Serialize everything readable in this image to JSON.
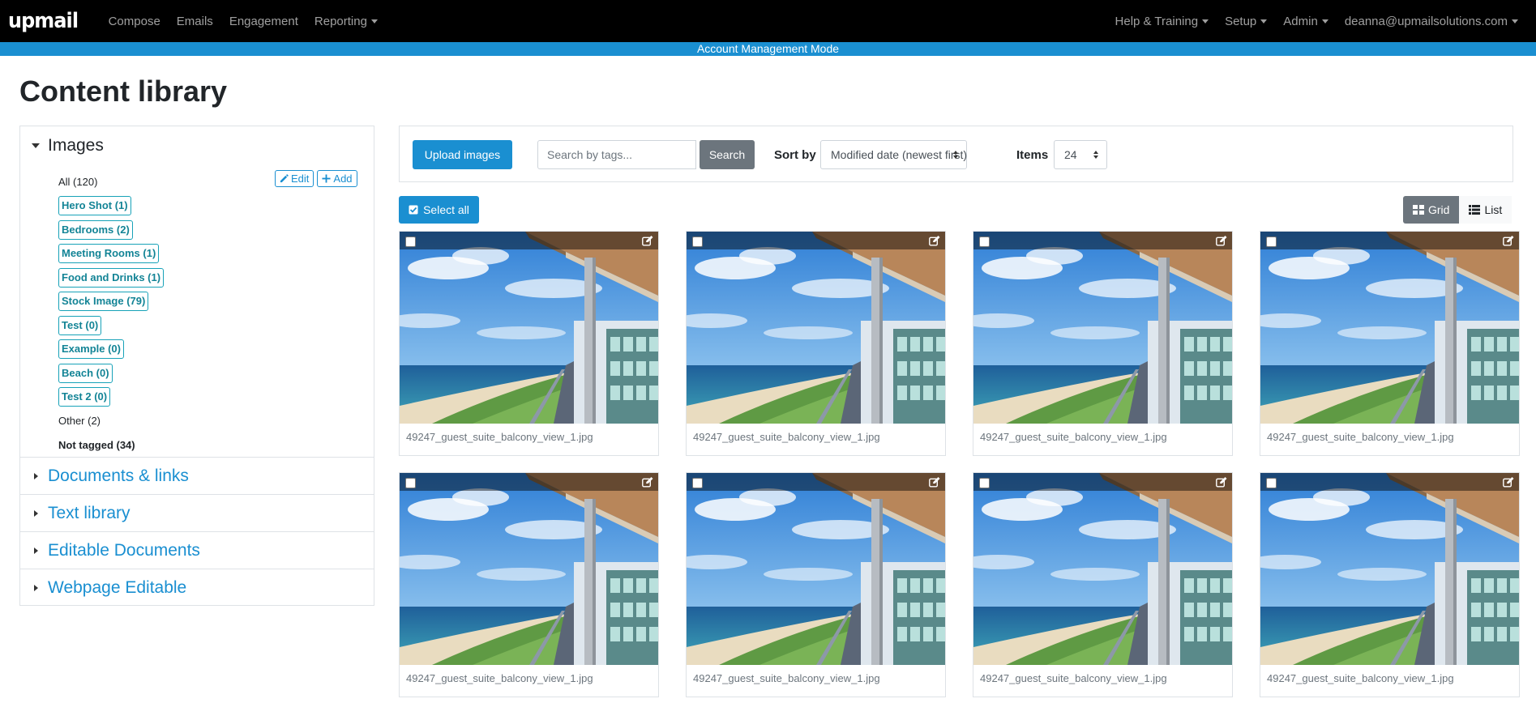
{
  "navbar": {
    "brand": "upmail",
    "left": [
      {
        "label": "Compose",
        "dropdown": false
      },
      {
        "label": "Emails",
        "dropdown": false
      },
      {
        "label": "Engagement",
        "dropdown": false
      },
      {
        "label": "Reporting",
        "dropdown": true
      }
    ],
    "right": [
      {
        "label": "Help & Training",
        "dropdown": true
      },
      {
        "label": "Setup",
        "dropdown": true
      },
      {
        "label": "Admin",
        "dropdown": true
      },
      {
        "label": "deanna@upmailsolutions.com",
        "dropdown": true
      }
    ]
  },
  "mode_banner": "Account Management Mode",
  "page_title": "Content library",
  "sidebar": {
    "images": {
      "title": "Images",
      "edit_label": "Edit",
      "add_label": "Add",
      "tags": [
        {
          "label": "All (120)",
          "style": "plain"
        },
        {
          "label": "Hero Shot (1)",
          "style": "badge"
        },
        {
          "label": "Bedrooms (2)",
          "style": "badge"
        },
        {
          "label": "Meeting Rooms (1)",
          "style": "badge"
        },
        {
          "label": "Food and Drinks (1)",
          "style": "badge"
        },
        {
          "label": "Stock Image (79)",
          "style": "badge"
        },
        {
          "label": "Test (0)",
          "style": "badge"
        },
        {
          "label": "Example (0)",
          "style": "badge"
        },
        {
          "label": "Beach (0)",
          "style": "badge"
        },
        {
          "label": "Test 2 (0)",
          "style": "badge"
        },
        {
          "label": "Other (2)",
          "style": "plain"
        },
        {
          "label": "Not tagged (34)",
          "style": "bold"
        }
      ]
    },
    "sections": [
      {
        "title": "Documents & links"
      },
      {
        "title": "Text library"
      },
      {
        "title": "Editable Documents"
      },
      {
        "title": "Webpage Editable"
      }
    ]
  },
  "toolbar": {
    "upload_label": "Upload images",
    "search_placeholder": "Search by tags...",
    "search_label": "Search",
    "sort_label": "Sort by",
    "sort_value": "Modified date (newest first)",
    "items_label": "Items",
    "items_value": "24"
  },
  "select_all_label": "Select all",
  "view": {
    "grid_label": "Grid",
    "list_label": "List",
    "active": "grid"
  },
  "images": [
    {
      "filename": "49247_guest_suite_balcony_view_1.jpg"
    },
    {
      "filename": "49247_guest_suite_balcony_view_1.jpg"
    },
    {
      "filename": "49247_guest_suite_balcony_view_1.jpg"
    },
    {
      "filename": "49247_guest_suite_balcony_view_1.jpg"
    },
    {
      "filename": "49247_guest_suite_balcony_view_1.jpg"
    },
    {
      "filename": "49247_guest_suite_balcony_view_1.jpg"
    },
    {
      "filename": "49247_guest_suite_balcony_view_1.jpg"
    },
    {
      "filename": "49247_guest_suite_balcony_view_1.jpg"
    }
  ],
  "colors": {
    "navbar_bg": "#000000",
    "accent": "#1a8fd1",
    "tag_badge": "#17a2b8",
    "secondary": "#6c757d"
  }
}
